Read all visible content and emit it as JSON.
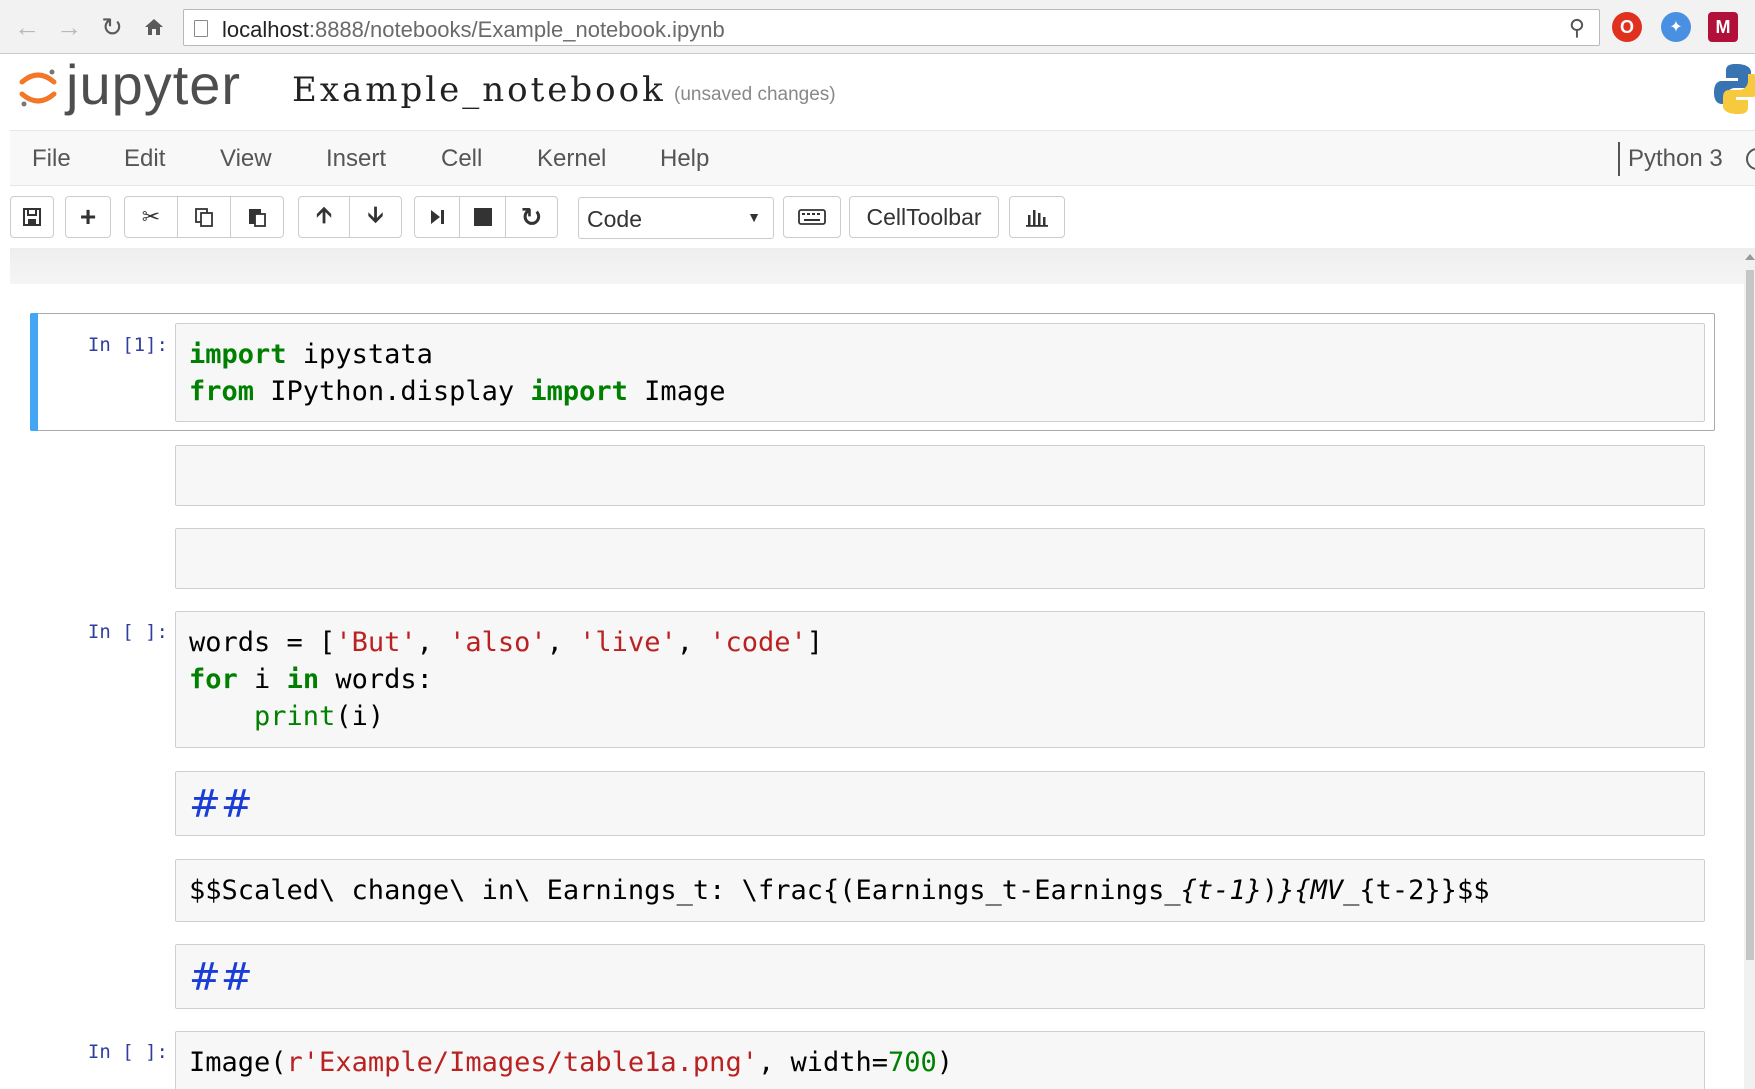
{
  "browser": {
    "url_host": "localhost",
    "url_path": ":8888/notebooks/Example_notebook.ipynb",
    "back_icon": "arrow-left-icon",
    "forward_icon": "arrow-right-icon",
    "reload_icon": "reload-icon",
    "home_icon": "home-icon",
    "zoom_icon": "zoom-icon"
  },
  "header": {
    "logo_text": "jupyter",
    "notebook_name": "Example_notebook",
    "save_status": "(unsaved changes)"
  },
  "menubar": {
    "items": [
      "File",
      "Edit",
      "View",
      "Insert",
      "Cell",
      "Kernel",
      "Help"
    ],
    "kernel_name": "Python 3"
  },
  "toolbar": {
    "cell_type": "Code",
    "celltoolbar_label": "CellToolbar"
  },
  "cells": [
    {
      "prompt": "In [1]:",
      "lines": [
        [
          [
            "kw",
            "import"
          ],
          [
            "t",
            " ipystata"
          ]
        ],
        [
          [
            "kw",
            "from"
          ],
          [
            "t",
            " IPython.display "
          ],
          [
            "kw",
            "import"
          ],
          [
            "t",
            " Image"
          ]
        ]
      ]
    },
    {
      "prompt": "",
      "lines": []
    },
    {
      "prompt": "",
      "lines": []
    },
    {
      "prompt": "In [ ]:",
      "lines": [
        [
          [
            "t",
            "words = ["
          ],
          [
            "str",
            "'But'"
          ],
          [
            "t",
            ", "
          ],
          [
            "str",
            "'also'"
          ],
          [
            "t",
            ", "
          ],
          [
            "str",
            "'live'"
          ],
          [
            "t",
            ", "
          ],
          [
            "str",
            "'code'"
          ],
          [
            "t",
            "]"
          ]
        ],
        [
          [
            "kw",
            "for"
          ],
          [
            "t",
            " i "
          ],
          [
            "kw",
            "in"
          ],
          [
            "t",
            " words:"
          ]
        ],
        [
          [
            "t",
            "    "
          ],
          [
            "bi",
            "print"
          ],
          [
            "t",
            "(i)"
          ]
        ]
      ]
    },
    {
      "prompt": "",
      "markdown": "##"
    },
    {
      "prompt": "",
      "lines": [
        [
          [
            "t",
            "$$Scaled\\ change\\ in\\ Earnings_t: \\frac{(Earnings_t-Earnings_"
          ],
          [
            "mi",
            "{t-1}"
          ],
          [
            "t",
            ")"
          ],
          [
            "mi",
            "}{MV_"
          ],
          [
            "t",
            "{t-2}}$$"
          ]
        ]
      ]
    },
    {
      "prompt": "",
      "markdown": "##"
    },
    {
      "prompt": "In [ ]:",
      "lines": [
        [
          [
            "t",
            "Image("
          ],
          [
            "str",
            "r'Example/Images/table1a.png'"
          ],
          [
            "t",
            ", width="
          ],
          [
            "num",
            "700"
          ],
          [
            "t",
            ")"
          ]
        ]
      ]
    }
  ]
}
